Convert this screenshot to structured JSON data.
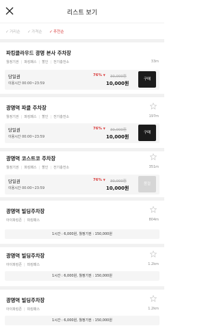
{
  "header": {
    "title": "리스트 보기",
    "close_icon": "close-icon"
  },
  "sort": [
    {
      "label": "거리순",
      "active": false
    },
    {
      "label": "가격순",
      "active": false
    },
    {
      "label": "추천순",
      "active": true
    }
  ],
  "colors": {
    "accent": "#d93b3b",
    "button_dark": "#1b1b1b",
    "button_disabled": "#d6d6d6"
  },
  "lots": [
    {
      "name": "파킹클라우드 광명 본사 주차장",
      "tags": [
        "월정기권",
        "파킹패스",
        "할인",
        "전기충전소"
      ],
      "distance": "33m",
      "ticket": {
        "name": "당일권",
        "time": "이용시간 00:00~23:59",
        "discount": "76%",
        "original": "30,000원",
        "price": "10,000원",
        "button": "구매",
        "enabled": true
      }
    },
    {
      "name": "광명역 파클 주차장",
      "tags": [
        "월정기권",
        "파킹패스",
        "할인",
        "전기충전소"
      ],
      "distance": "197m",
      "ticket": {
        "name": "당일권",
        "time": "이용시간 00:00~23:59",
        "discount": "76%",
        "original": "30,000원",
        "price": "10,000원",
        "button": "구매",
        "enabled": true
      }
    },
    {
      "name": "광명역 코스트코 주차장",
      "tags": [
        "월정기권",
        "파킹패스",
        "할인",
        "전기충전소"
      ],
      "distance": "351m",
      "ticket": {
        "name": "당일권",
        "time": "이용시간 00:00~23:59",
        "discount": "76%",
        "original": "30,000원",
        "price": "10,000원",
        "button": "품절",
        "enabled": false
      }
    },
    {
      "name": "광명역 빌딩주차장",
      "tags": [
        "아이파킹존",
        "파킹패스"
      ],
      "distance": "804m",
      "price_info": "1시간 : 6,000원, 월정기권 : 150,000원"
    },
    {
      "name": "광명역 빌딩주차장",
      "tags": [
        "아이파킹존",
        "파킹패스"
      ],
      "distance": "1.2km",
      "price_info": "1시간 : 6,000원, 월정기권 : 150,000원"
    },
    {
      "name": "광명역 빌딩주차장",
      "tags": [
        "아이파킹존",
        "파킹패스"
      ],
      "distance": "1.2km",
      "price_info": "1시간 : 6,000원, 월정기권 : 150,000원"
    }
  ]
}
